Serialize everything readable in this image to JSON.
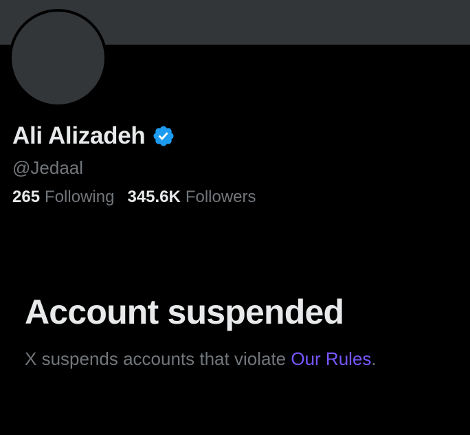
{
  "profile": {
    "display_name": "Ali Alizadeh",
    "verified_icon": "verified-badge-icon",
    "handle": "@Jedaal",
    "following_count": "265",
    "following_label": "Following",
    "followers_count": "345.6K",
    "followers_label": "Followers"
  },
  "suspension": {
    "title": "Account suspended",
    "message_prefix": "X suspends accounts that violate ",
    "rules_link": "Our Rules",
    "message_suffix": "."
  },
  "colors": {
    "background": "#000000",
    "banner": "#333639",
    "primary_text": "#e7e9ea",
    "secondary_text": "#71767b",
    "verified_blue": "#1d9bf0",
    "link": "#7856ff"
  }
}
